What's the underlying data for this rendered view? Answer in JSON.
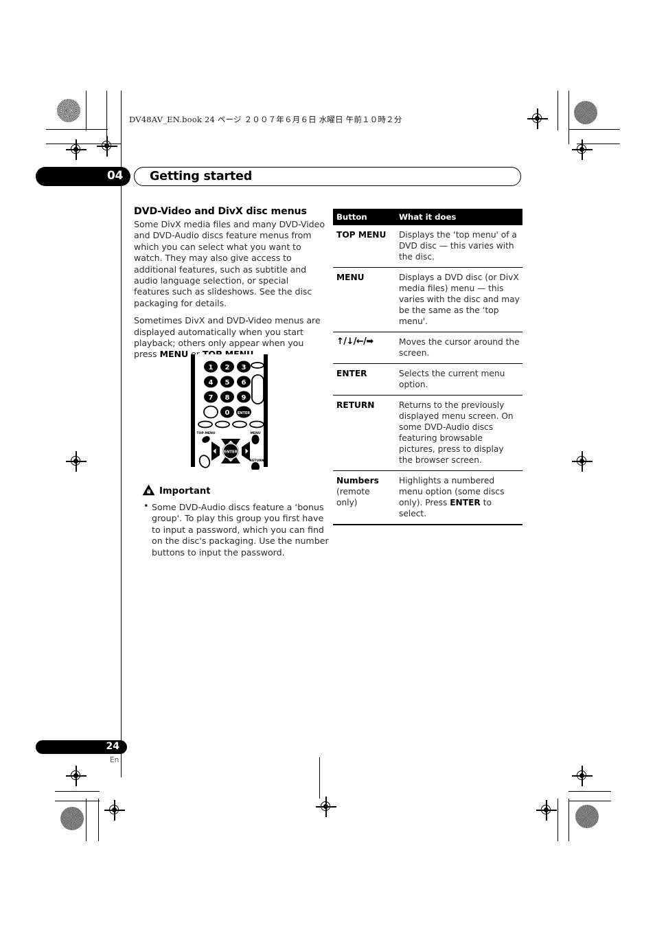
{
  "book_header": "DV48AV_EN.book   24 ページ   ２００７年６月６日   水曜日   午前１０時２分",
  "chapter": {
    "number": "04",
    "title": "Getting started"
  },
  "left_column": {
    "section_title": "DVD-Video and DivX disc menus",
    "paragraph_1": "Some DivX media files and many DVD-Video and DVD-Audio discs feature menus from which you can select what you want to watch. They may also give access to additional features, such as subtitle and audio language selection, or special features such as slideshows. See the disc packaging for details.",
    "paragraph_2_part1": "Sometimes DivX and DVD-Video menus are displayed automatically when you start playback; others only appear when you press ",
    "paragraph_2_bold1": "MENU",
    "paragraph_2_mid": " or ",
    "paragraph_2_bold2": "TOP MENU",
    "paragraph_2_end": "."
  },
  "remote": {
    "keys": [
      "1",
      "2",
      "3",
      "4",
      "5",
      "6",
      "7",
      "8",
      "9",
      "0"
    ],
    "enter_label": "ENTER",
    "center_label": "ENTER",
    "top_menu_label": "TOP MENU",
    "menu_label": "MENU",
    "return_label": "RETURN"
  },
  "important": {
    "icon": "warning-hand-icon",
    "title": "Important",
    "bullets": [
      "Some DVD-Audio discs feature a ‘bonus group'. To play this group you first have to input a password, which you can find on the disc's packaging. Use the number buttons to input the password."
    ]
  },
  "table": {
    "headers": [
      "Button",
      "What it does"
    ],
    "rows": [
      {
        "button": "TOP MENU",
        "sub": "",
        "desc_pre": "Displays the ‘top menu' of a DVD disc — this varies with the disc.",
        "desc_bold": "",
        "desc_post": ""
      },
      {
        "button": "MENU",
        "sub": "",
        "desc_pre": "Displays a DVD disc (or DivX media files) menu — this varies with the disc and may be the same as the ‘top menu'.",
        "desc_bold": "",
        "desc_post": ""
      },
      {
        "button": "↑/↓/←/➡",
        "sub": "",
        "desc_pre": "Moves the cursor around the screen.",
        "desc_bold": "",
        "desc_post": ""
      },
      {
        "button": "ENTER",
        "sub": "",
        "desc_pre": "Selects the current menu option.",
        "desc_bold": "",
        "desc_post": ""
      },
      {
        "button": "RETURN",
        "sub": "",
        "desc_pre": "Returns to the previously displayed menu screen. On some DVD-Audio discs featuring browsable pictures, press to display the browser screen.",
        "desc_bold": "",
        "desc_post": ""
      },
      {
        "button": "Numbers",
        "sub": "(remote only)",
        "desc_pre": "Highlights a numbered menu option (some discs only). Press ",
        "desc_bold": "ENTER",
        "desc_post": " to select."
      }
    ]
  },
  "footer": {
    "page_number": "24",
    "language": "En"
  }
}
